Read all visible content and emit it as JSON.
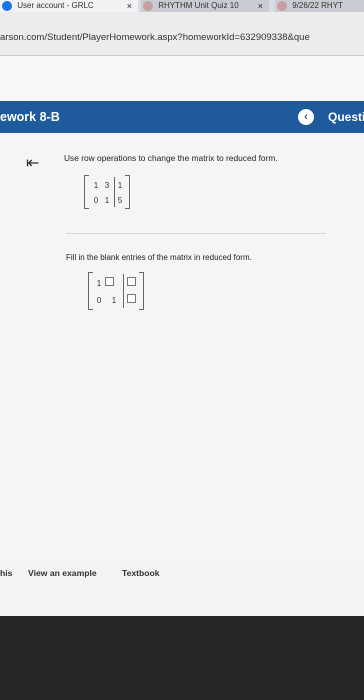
{
  "browser": {
    "tabs": [
      {
        "label": "User account - GRLC",
        "close": "×"
      },
      {
        "label": "RHYTHM Unit Quiz 10",
        "close": "×"
      },
      {
        "label": "9/26/22 RHYT"
      }
    ],
    "url": "arson.com/Student/PlayerHomework.aspx?homeworkId=632909338&que"
  },
  "header": {
    "title": "ework 8-B",
    "back_symbol": "‹",
    "question_label": "Questi"
  },
  "question": {
    "collapse_symbol": "⇤",
    "instruction": "Use row operations to change the matrix to reduced form.",
    "matrix": [
      [
        "1",
        "3",
        "1"
      ],
      [
        "0",
        "1",
        "5"
      ]
    ],
    "fill_prompt": "Fill in the blank entries of the matrix in reduced form.",
    "answer_matrix": [
      [
        "1",
        "",
        ""
      ],
      [
        "0",
        "1",
        ""
      ]
    ]
  },
  "bottom_bar": {
    "left_cut": "his",
    "view_example": "View an example",
    "textbook": "Textbook"
  }
}
